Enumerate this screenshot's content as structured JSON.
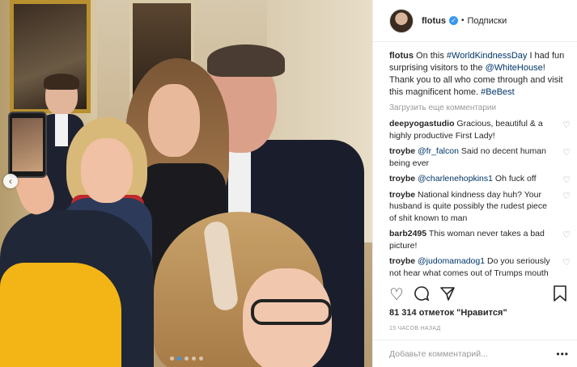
{
  "post": {
    "username": "flotus",
    "separator": "•",
    "follow_label": "Подписки",
    "caption": {
      "user": "flotus",
      "part1": " On this ",
      "tag1": "#WorldKindnessDay",
      "part2": " I had fun surprising visitors to the ",
      "tag2": "@WhiteHouse",
      "part3": "! Thank you to all who come through and visit this magnificent home. ",
      "tag3": "#BeBest"
    },
    "load_more": "Загрузить еще комментарии",
    "comments": [
      {
        "user": "deepyogastudio",
        "mention": "",
        "text": " Gracious, beautiful & a highly productive First Lady!"
      },
      {
        "user": "troybe",
        "mention": "@fr_falcon",
        "text": " Said no decent human being ever"
      },
      {
        "user": "troybe",
        "mention": "@charlenehopkins1",
        "text": " Oh fuck off"
      },
      {
        "user": "troybe",
        "mention": "",
        "text": " National kindness day huh? Your husband is quite possibly the rudest piece of shit known to man"
      },
      {
        "user": "barb2495",
        "mention": "",
        "text": " This woman never takes a bad picture!"
      },
      {
        "user": "troybe",
        "mention": "@judomamadog1",
        "text": " Do you seriously not hear what comes out of Trumps mouth every single fucking"
      }
    ],
    "likes": "81 314 отметок \"Нравится\"",
    "time": "15 ЧАСОВ НАЗАД",
    "comment_placeholder": "Добавьте комментарий...",
    "more_label": "•••",
    "carousel": {
      "total": 5,
      "active": 1
    }
  },
  "icons": {
    "heart": "heart-icon",
    "comment": "comment-icon",
    "share": "share-icon",
    "save": "bookmark-icon",
    "verified": "verified-badge-icon",
    "prev": "chevron-left-icon"
  },
  "colors": {
    "link": "#003569",
    "verified": "#3897f0",
    "muted": "#999999"
  }
}
